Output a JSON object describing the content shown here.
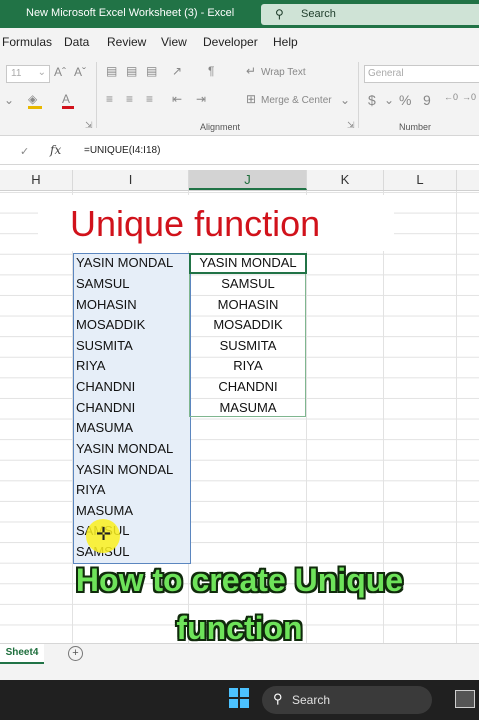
{
  "window": {
    "title": "New Microsoft Excel Worksheet (3)  -  Excel",
    "search_label": "Search",
    "accent": "#217346"
  },
  "menu": [
    "Formulas",
    "Data",
    "Review",
    "View",
    "Developer",
    "Help"
  ],
  "ribbon": {
    "font_size": "11",
    "wrap_text": "Wrap Text",
    "merge_center": "Merge & Center",
    "number_format": "General",
    "currency_symbol": "$",
    "percent_symbol": "%",
    "comma_symbol": "9",
    "alignment_group": "Alignment",
    "number_group": "Number"
  },
  "formula_bar": {
    "formula": "=UNIQUE(I4:I18)"
  },
  "columns": [
    "H",
    "I",
    "J",
    "K",
    "L"
  ],
  "heading": {
    "text": "Unique function",
    "color": "#d1121b"
  },
  "column_i": [
    "YASIN MONDAL",
    "SAMSUL",
    "MOHASIN",
    "MOSADDIK",
    "SUSMITA",
    "RIYA",
    "CHANDNI",
    "CHANDNI",
    "MASUMA",
    "YASIN MONDAL",
    "YASIN MONDAL",
    "RIYA",
    "MASUMA",
    "SAMSUL",
    "SAMSUL"
  ],
  "column_j": [
    "YASIN MONDAL",
    "SAMSUL",
    "MOHASIN",
    "MOSADDIK",
    "SUSMITA",
    "RIYA",
    "CHANDNI",
    "MASUMA"
  ],
  "caption": {
    "line1": "How to create Unique",
    "line2": "function",
    "color": "#6ee35a"
  },
  "sheet_tab": "Sheet4",
  "taskbar": {
    "search_label": "Search"
  }
}
